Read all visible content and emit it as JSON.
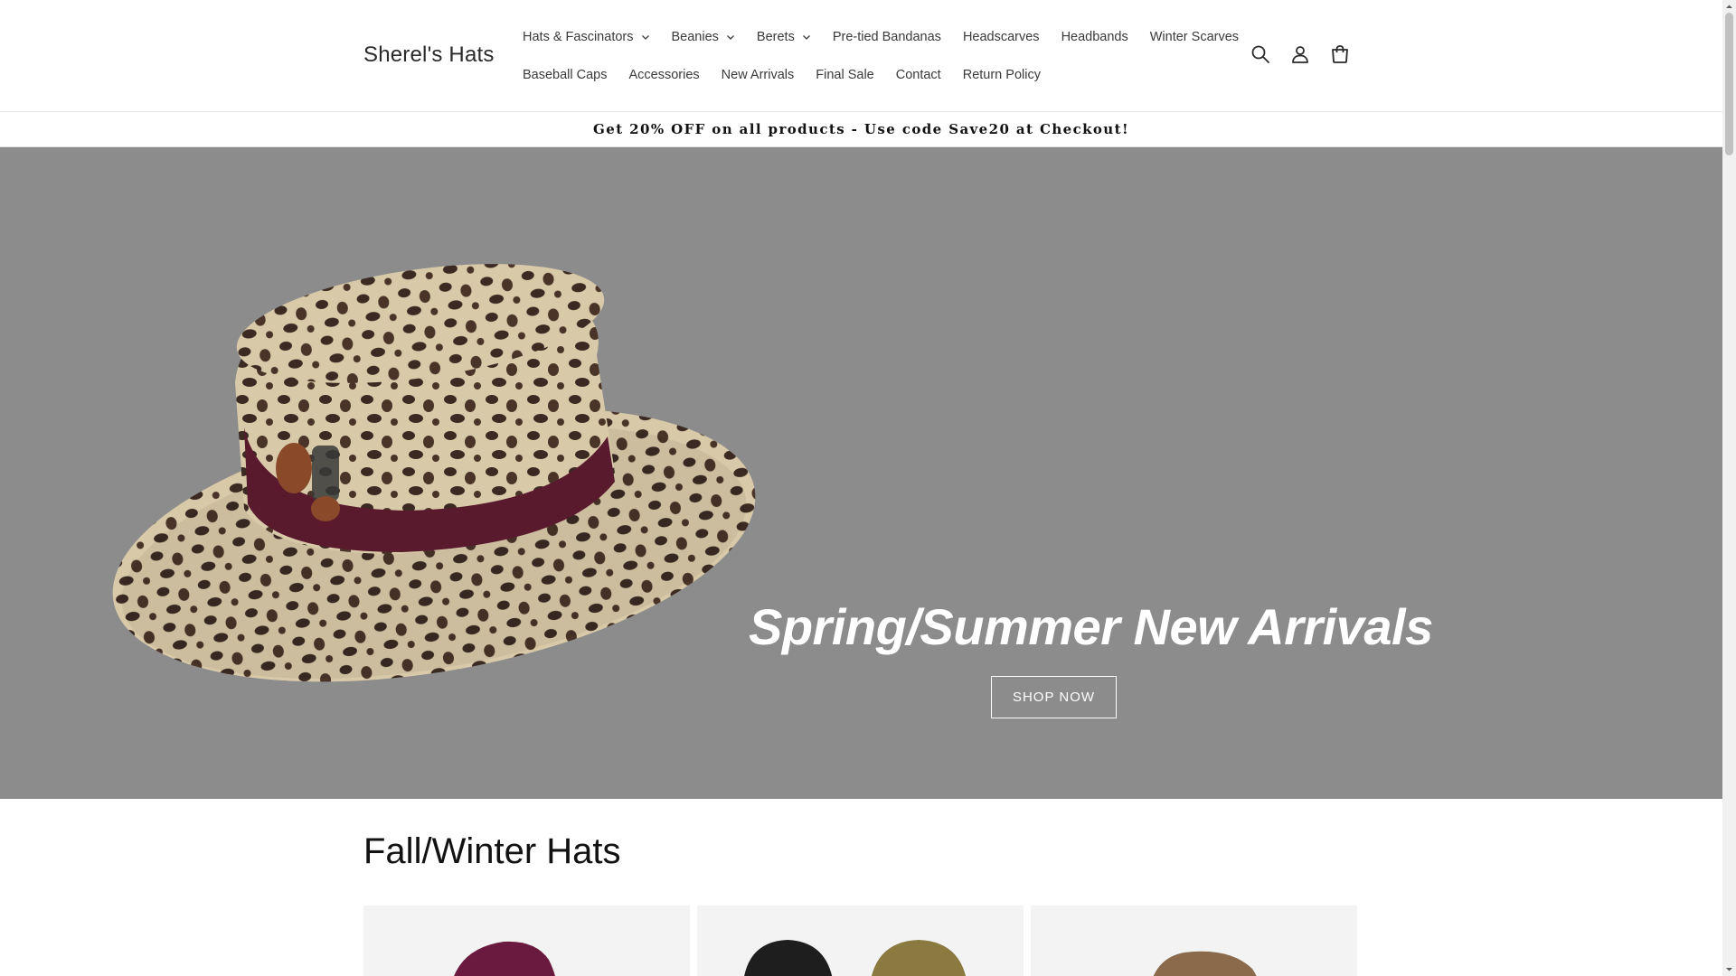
{
  "header": {
    "logo": "Sherel's Hats",
    "nav_row1": [
      {
        "label": "Hats & Fascinators",
        "has_dropdown": true
      },
      {
        "label": "Beanies",
        "has_dropdown": true
      },
      {
        "label": "Berets",
        "has_dropdown": true
      },
      {
        "label": "Pre-tied Bandanas",
        "has_dropdown": false
      },
      {
        "label": "Headscarves",
        "has_dropdown": false
      },
      {
        "label": "Headbands",
        "has_dropdown": false
      },
      {
        "label": "Winter Scarves",
        "has_dropdown": false
      }
    ],
    "nav_row2": [
      {
        "label": "Baseball Caps",
        "has_dropdown": false
      },
      {
        "label": "Accessories",
        "has_dropdown": false
      },
      {
        "label": "New Arrivals",
        "has_dropdown": false
      },
      {
        "label": "Final Sale",
        "has_dropdown": false
      },
      {
        "label": "Contact",
        "has_dropdown": false
      },
      {
        "label": "Return Policy",
        "has_dropdown": false
      }
    ],
    "icons": [
      "search-icon",
      "account-icon",
      "cart-icon"
    ]
  },
  "announcement": "Get 20% OFF on all products - Use code Save20 at Checkout!",
  "hero": {
    "title": "Spring/Summer New Arrivals",
    "button_label": "SHOP NOW",
    "background_color": "#8c8c8c"
  },
  "collection": {
    "title": "Fall/Winter Hats"
  }
}
